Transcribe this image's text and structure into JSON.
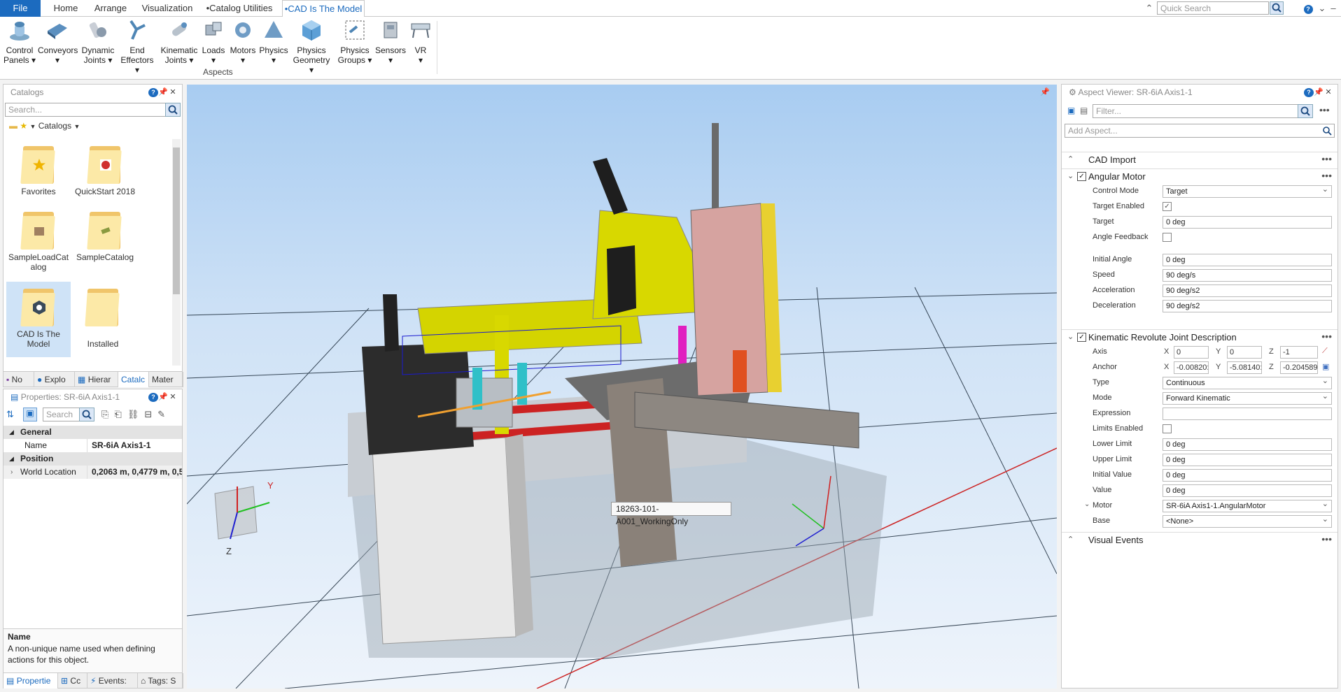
{
  "tabs": [
    {
      "label": "File"
    },
    {
      "label": "Home"
    },
    {
      "label": "Arrange"
    },
    {
      "label": "Visualization"
    },
    {
      "label": "•Catalog Utilities"
    },
    {
      "label": "•CAD Is The Model"
    }
  ],
  "quick_search": {
    "placeholder": "Quick Search"
  },
  "ribbon": {
    "buttons": [
      {
        "l1": "Control",
        "l2": "Panels ▾"
      },
      {
        "l1": "Conveyors",
        "l2": "▾"
      },
      {
        "l1": "Dynamic",
        "l2": "Joints ▾"
      },
      {
        "l1": "End",
        "l2": "Effectors ▾"
      },
      {
        "l1": "Kinematic",
        "l2": "Joints ▾"
      },
      {
        "l1": "Loads",
        "l2": "▾"
      },
      {
        "l1": "Motors",
        "l2": "▾"
      },
      {
        "l1": "Physics",
        "l2": "▾"
      },
      {
        "l1": "Physics",
        "l2": "Geometry ▾"
      },
      {
        "l1": "Physics",
        "l2": "Groups ▾"
      },
      {
        "l1": "Sensors",
        "l2": "▾"
      },
      {
        "l1": "VR",
        "l2": "▾"
      }
    ],
    "group_label": "Aspects"
  },
  "catalogs": {
    "title": "Catalogs",
    "search_placeholder": "Search...",
    "breadcrumb": "Catalogs",
    "items": [
      {
        "label": "Favorites"
      },
      {
        "label": "QuickStart 2018"
      },
      {
        "label": "SampleLoadCatalog"
      },
      {
        "label": "SampleCatalog"
      },
      {
        "label": "CAD Is The Model"
      },
      {
        "label": "Installed"
      }
    ],
    "bottom_tabs": [
      {
        "label": "No"
      },
      {
        "label": "Explo"
      },
      {
        "label": "Hierar"
      },
      {
        "label": "Catalc"
      },
      {
        "label": "Mater"
      }
    ]
  },
  "properties": {
    "title": "Properties: SR-6iA Axis1-1",
    "search_placeholder": "Search",
    "groups": [
      {
        "name": "General",
        "rows": [
          {
            "name": "Name",
            "value": "SR-6iA Axis1-1"
          }
        ]
      },
      {
        "name": "Position",
        "rows": [
          {
            "name": "World Location",
            "value": "0,2063 m, 0,4779 m, 0,5"
          }
        ]
      }
    ],
    "description_title": "Name",
    "description_text": "A non-unique name used when defining actions for this object.",
    "bottom_tabs": [
      {
        "label": "Propertie"
      },
      {
        "label": "Cc"
      },
      {
        "label": "Events:"
      },
      {
        "label": "Tags: S"
      }
    ]
  },
  "viewport": {
    "tooltip": "18263-101-A001_WorkingOnly",
    "axis_labels": {
      "y": "Y",
      "z": "Z"
    }
  },
  "aspect_viewer": {
    "title": "Aspect Viewer: SR-6iA Axis1-1",
    "filter_placeholder": "Filter...",
    "add_placeholder": "Add Aspect...",
    "sections": {
      "cad_import": "CAD Import",
      "angular_motor": "Angular Motor",
      "krj": "Kinematic Revolute Joint Description",
      "visual_events": "Visual Events"
    },
    "motor": {
      "control_mode_label": "Control Mode",
      "control_mode": "Target",
      "target_enabled_label": "Target Enabled",
      "target_label": "Target",
      "target": "0 deg",
      "angle_feedback_label": "Angle Feedback",
      "initial_angle_label": "Initial Angle",
      "initial_angle": "0 deg",
      "speed_label": "Speed",
      "speed": "90 deg/s",
      "accel_label": "Acceleration",
      "accel": "90 deg/s2",
      "decel_label": "Deceleration",
      "decel": "90 deg/s2"
    },
    "joint": {
      "axis_label": "Axis",
      "axis_x": "0",
      "axis_y": "0",
      "axis_z": "-1",
      "anchor_label": "Anchor",
      "anchor_x": "-0.00820:",
      "anchor_y": "-5.08140:",
      "anchor_z": "-0.204589",
      "x": "X",
      "y": "Y",
      "z": "Z",
      "type_label": "Type",
      "type": "Continuous",
      "mode_label": "Mode",
      "mode": "Forward Kinematic",
      "expression_label": "Expression",
      "limits_label": "Limits Enabled",
      "lower_label": "Lower Limit",
      "lower": "0 deg",
      "upper_label": "Upper Limit",
      "upper": "0 deg",
      "initial_label": "Initial Value",
      "initial": "0 deg",
      "value_label": "Value",
      "value": "0 deg",
      "motor_label": "Motor",
      "motor": "SR-6iA Axis1-1.AngularMotor",
      "base_label": "Base",
      "base": "<None>"
    }
  },
  "colors": {
    "accent": "#1c6bbf",
    "robot_yellow": "#d8d800",
    "conveyor_red": "#cc2222"
  }
}
